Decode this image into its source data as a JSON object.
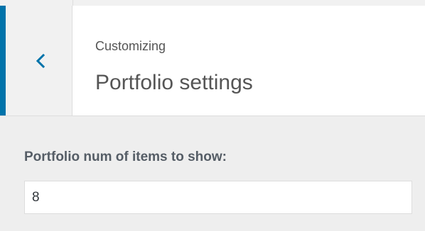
{
  "header": {
    "breadcrumb": "Customizing",
    "title": "Portfolio settings",
    "back_icon": "chevron-left-icon"
  },
  "control": {
    "label": "Portfolio num of items to show:",
    "value": "8"
  },
  "colors": {
    "accent": "#0073aa",
    "panel_background": "#eeeeee",
    "header_background": "#ffffff"
  }
}
